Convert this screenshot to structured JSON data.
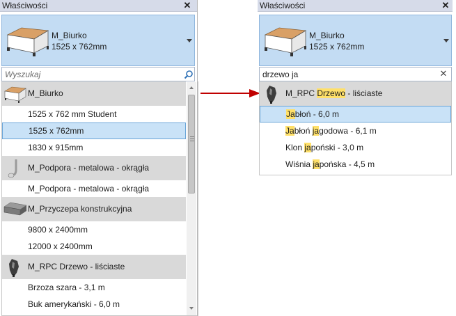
{
  "left": {
    "title": "Właściwości",
    "close_glyph": "✕",
    "type": {
      "name": "M_Biurko",
      "size": "1525 x 762mm"
    },
    "search": {
      "placeholder": "Wyszukaj",
      "value": ""
    },
    "list": [
      {
        "kind": "family",
        "label": "M_Biurko",
        "thumb": "desk"
      },
      {
        "kind": "type",
        "label": "1525 x 762 mm Student"
      },
      {
        "kind": "type",
        "label": "1525 x 762mm",
        "selected": true
      },
      {
        "kind": "type",
        "label": "1830 x 915mm"
      },
      {
        "kind": "family",
        "label": "M_Podpora - metalowa - okrągła",
        "thumb": "pipe"
      },
      {
        "kind": "type",
        "label": "M_Podpora - metalowa - okrągła"
      },
      {
        "kind": "family",
        "label": "M_Przyczepa konstrukcyjna",
        "thumb": "trailer"
      },
      {
        "kind": "type",
        "label": "9800 x 2400mm"
      },
      {
        "kind": "type",
        "label": "12000 x 2400mm"
      },
      {
        "kind": "family",
        "label": "M_RPC Drzewo - liściaste",
        "thumb": "tree"
      },
      {
        "kind": "type",
        "label": "Brzoza szara - 3,1 m"
      },
      {
        "kind": "type",
        "label": "Buk amerykański - 6,0 m"
      }
    ]
  },
  "right": {
    "title": "Właściwości",
    "close_glyph": "✕",
    "type": {
      "name": "M_Biurko",
      "size": "1525 x 762mm"
    },
    "search": {
      "value": "drzewo ja",
      "clear_glyph": "✕"
    },
    "list": [
      {
        "kind": "family",
        "thumb": "tree",
        "parts": [
          {
            "t": "M_RPC "
          },
          {
            "t": "Drzewo",
            "hl": true
          },
          {
            "t": " - liściaste"
          }
        ]
      },
      {
        "kind": "type",
        "selected": true,
        "parts": [
          {
            "t": "Ja",
            "hl": true
          },
          {
            "t": "błoń - 6,0 m"
          }
        ]
      },
      {
        "kind": "type",
        "parts": [
          {
            "t": "Ja",
            "hl": true
          },
          {
            "t": "błoń "
          },
          {
            "t": "ja",
            "hl": true
          },
          {
            "t": "godowa - 6,1 m"
          }
        ]
      },
      {
        "kind": "type",
        "parts": [
          {
            "t": "Klon "
          },
          {
            "t": "ja",
            "hl": true
          },
          {
            "t": "poński - 3,0 m"
          }
        ]
      },
      {
        "kind": "type",
        "parts": [
          {
            "t": "Wiśnia "
          },
          {
            "t": "ja",
            "hl": true
          },
          {
            "t": "pońska - 4,5 m"
          }
        ]
      }
    ]
  },
  "colors": {
    "selection": "#c9e2f7",
    "highlight": "#ffe069",
    "arrow": "#c00000",
    "family_row": "#d9d9d9"
  },
  "icons": {
    "search": "search-icon",
    "close": "close-icon",
    "dropdown": "chevron-down-icon",
    "arrow": "right-arrow-icon"
  }
}
